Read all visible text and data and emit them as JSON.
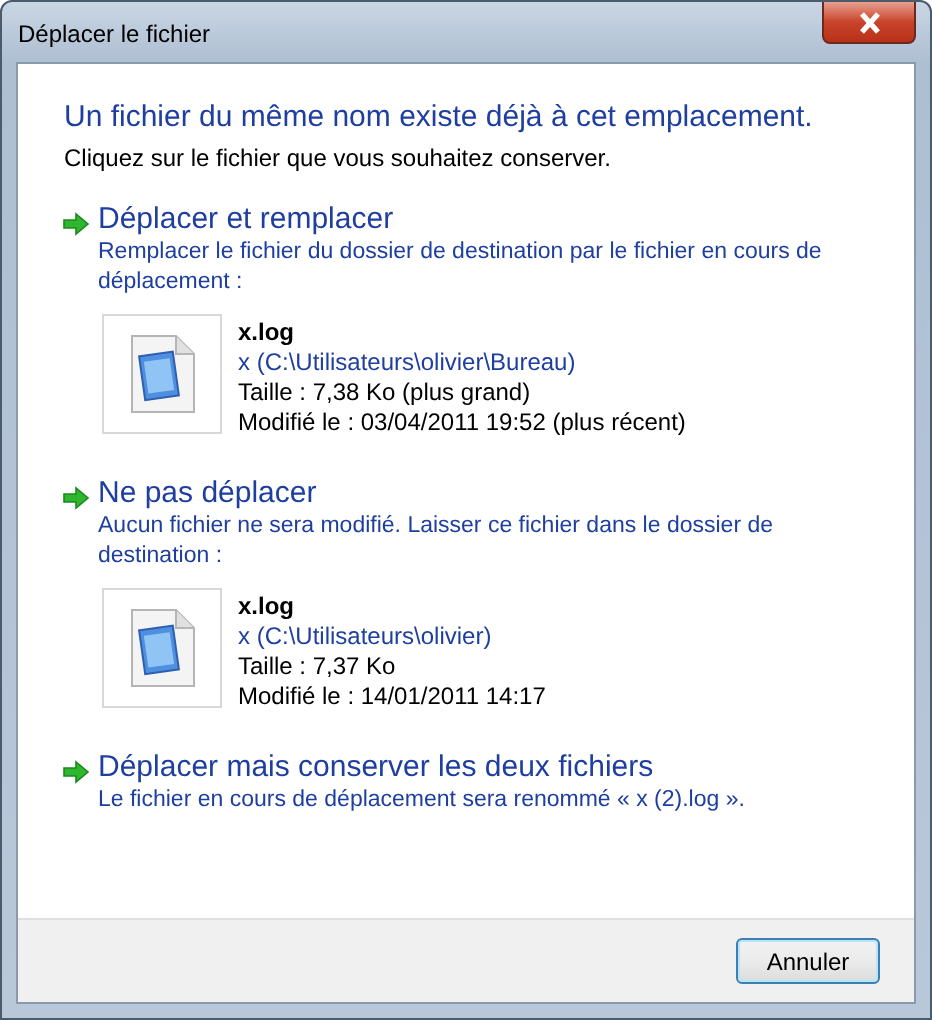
{
  "window": {
    "title": "Déplacer le fichier"
  },
  "heading": "Un fichier du même nom existe déjà à cet emplacement.",
  "instruction": "Cliquez sur le fichier que vous souhaitez conserver.",
  "options": [
    {
      "title": "Déplacer et remplacer",
      "description": "Remplacer le fichier du dossier de destination par le fichier en cours de déplacement :",
      "file": {
        "name": "x.log",
        "location": "x (C:\\Utilisateurs\\olivier\\Bureau)",
        "size": "Taille : 7,38 Ko (plus grand)",
        "modified": "Modifié le : 03/04/2011 19:52 (plus récent)"
      }
    },
    {
      "title": "Ne pas déplacer",
      "description": "Aucun fichier ne sera modifié. Laisser ce fichier dans le dossier de destination :",
      "file": {
        "name": "x.log",
        "location": "x (C:\\Utilisateurs\\olivier)",
        "size": "Taille : 7,37 Ko",
        "modified": "Modifié le : 14/01/2011 14:17"
      }
    },
    {
      "title": "Déplacer mais conserver les deux fichiers",
      "description": "Le fichier en cours de déplacement sera renommé « x (2).log »."
    }
  ],
  "buttons": [
    "Annuler"
  ]
}
